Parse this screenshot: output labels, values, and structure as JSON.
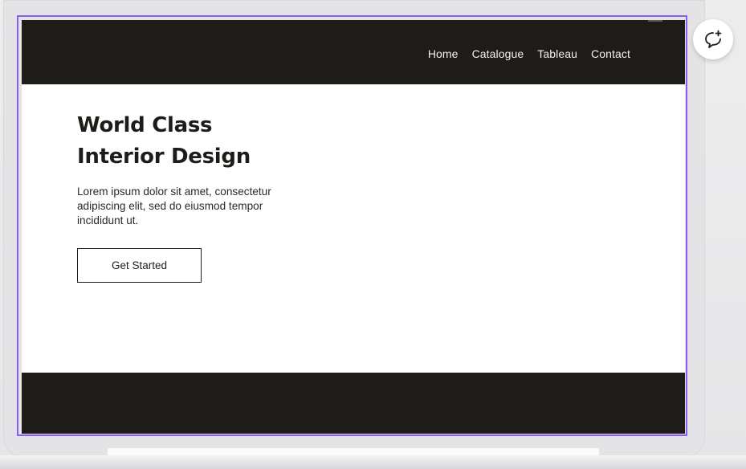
{
  "nav": {
    "items": [
      {
        "label": "Home"
      },
      {
        "label": "Catalogue"
      },
      {
        "label": "Tableau"
      },
      {
        "label": "Contact"
      }
    ]
  },
  "hero": {
    "title_line1": "World Class",
    "title_line2": "Interior Design",
    "description": "Lorem ipsum dolor sit amet, consectetur adipiscing elit, sed do eiusmod tempor incididunt ut.",
    "cta_label": "Get Started"
  },
  "icons": {
    "comment": "add-comment-icon"
  },
  "colors": {
    "dark": "#1e1c19",
    "selection": "#8b5cf6",
    "background": "#ffffff"
  }
}
